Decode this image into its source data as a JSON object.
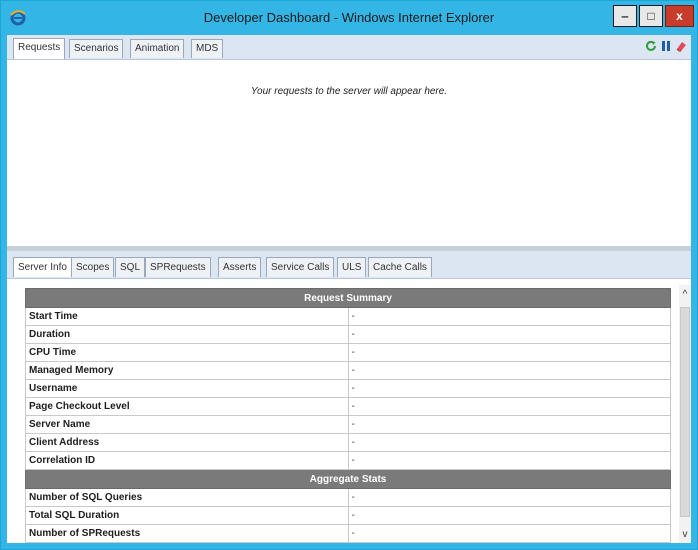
{
  "window": {
    "title": "Developer Dashboard - Windows Internet Explorer",
    "minimize": "‒",
    "maximize": "□",
    "close": "x",
    "accent_color": "#33b5e6",
    "close_color": "#c83c2b"
  },
  "top_tabs": [
    {
      "label": "Requests",
      "active": true
    },
    {
      "label": "Scenarios",
      "active": false
    },
    {
      "label": "Animation",
      "active": false
    },
    {
      "label": "MDS",
      "active": false
    }
  ],
  "top_icons": [
    "refresh-icon",
    "pause-icon",
    "eraser-icon"
  ],
  "requests": {
    "placeholder": "Your requests to the server will appear here."
  },
  "bottom_tabs": [
    {
      "label": "Server Info",
      "active": true
    },
    {
      "label": "Scopes",
      "active": false
    },
    {
      "label": "SQL",
      "active": false
    },
    {
      "label": "SPRequests",
      "active": false
    },
    {
      "label": "Asserts",
      "active": false
    },
    {
      "label": "Service Calls",
      "active": false
    },
    {
      "label": "ULS",
      "active": false
    },
    {
      "label": "Cache Calls",
      "active": false
    }
  ],
  "server_info": {
    "sections": [
      {
        "title": "Request Summary",
        "rows": [
          {
            "label": "Start Time",
            "value": "-"
          },
          {
            "label": "Duration",
            "value": "-"
          },
          {
            "label": "CPU Time",
            "value": "-"
          },
          {
            "label": "Managed Memory",
            "value": "-"
          },
          {
            "label": "Username",
            "value": "-"
          },
          {
            "label": "Page Checkout Level",
            "value": "-"
          },
          {
            "label": "Server Name",
            "value": "-"
          },
          {
            "label": "Client Address",
            "value": "-"
          },
          {
            "label": "Correlation ID",
            "value": "-"
          }
        ]
      },
      {
        "title": "Aggregate Stats",
        "rows": [
          {
            "label": "Number of SQL Queries",
            "value": "-"
          },
          {
            "label": "Total SQL Duration",
            "value": "-"
          },
          {
            "label": "Number of SPRequests",
            "value": "-"
          }
        ]
      }
    ]
  },
  "scrollbar": {
    "up": "^",
    "down": "v"
  }
}
